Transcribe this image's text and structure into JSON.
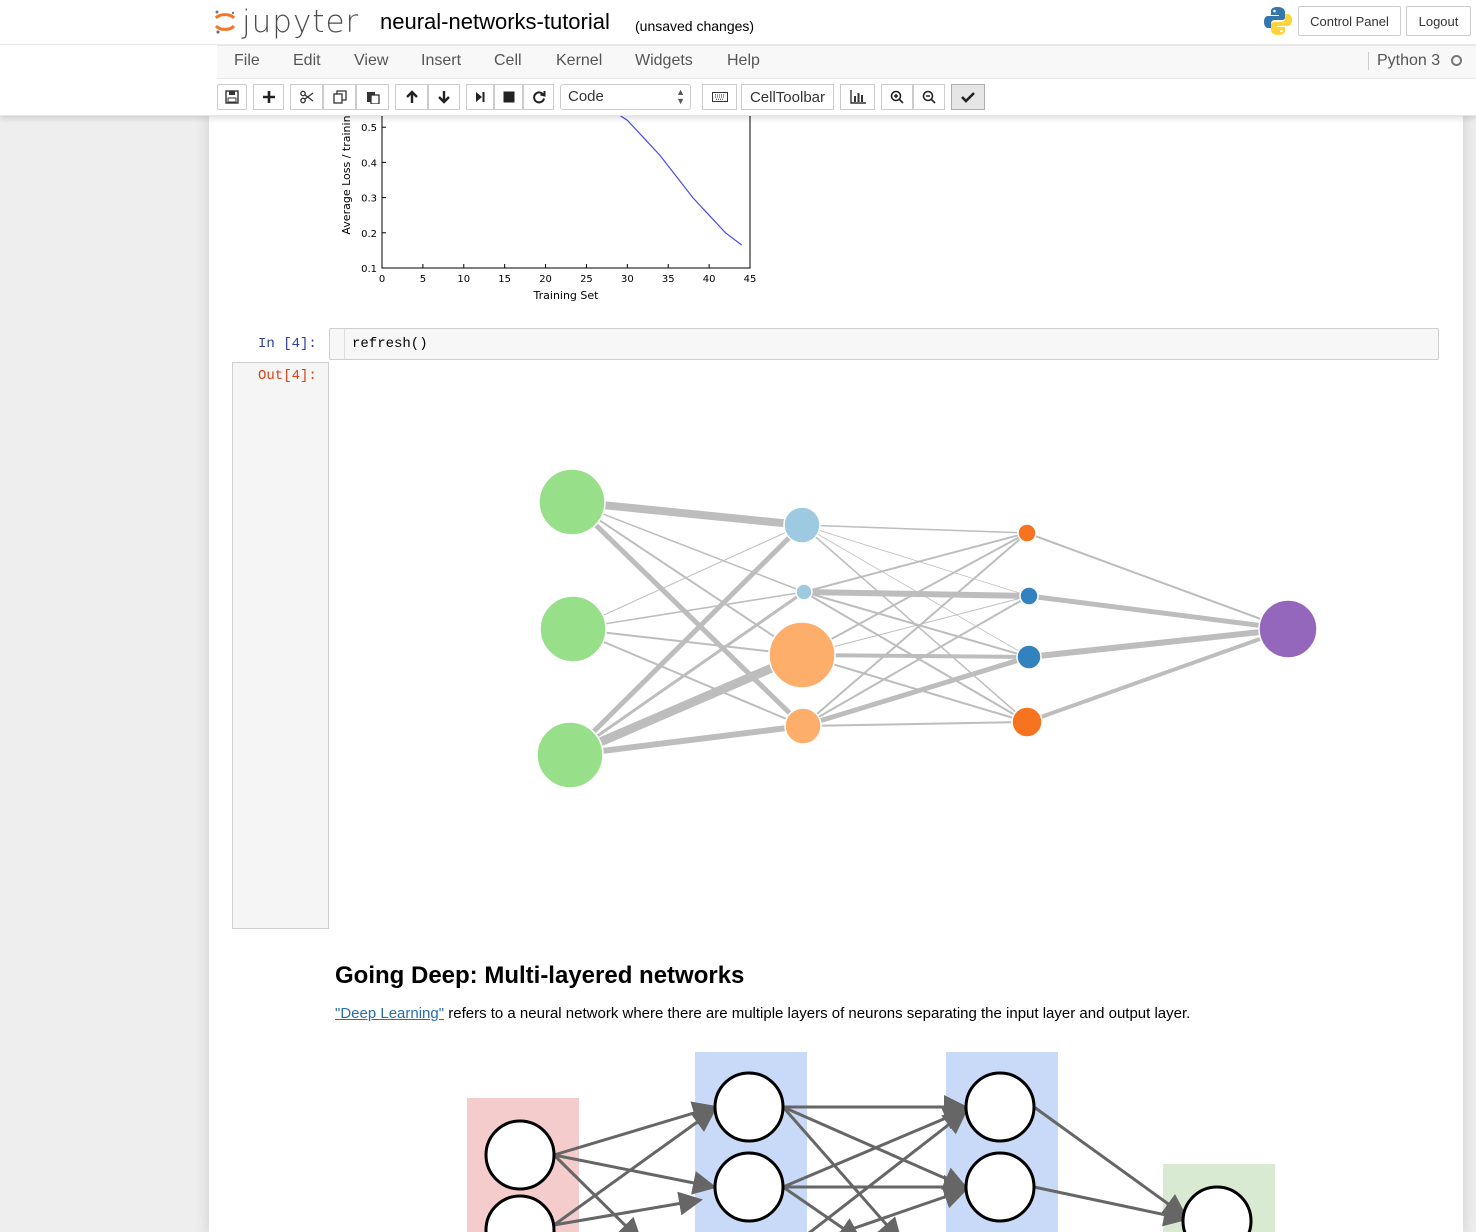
{
  "header": {
    "logo_text": "jupyter",
    "notebook_name": "neural-networks-tutorial",
    "save_status": "(unsaved changes)",
    "control_panel_label": "Control Panel",
    "logout_label": "Logout"
  },
  "menubar": {
    "items": [
      "File",
      "Edit",
      "View",
      "Insert",
      "Cell",
      "Kernel",
      "Widgets",
      "Help"
    ],
    "kernel_name": "Python 3"
  },
  "toolbar": {
    "icons": [
      "save-icon",
      "plus-icon",
      "cut-icon",
      "copy-icon",
      "paste-icon",
      "arrow-up-icon",
      "arrow-down-icon",
      "step-forward-icon",
      "stop-icon",
      "restart-icon"
    ],
    "cell_type": "Code",
    "celltoolbar_label": "CellToolbar"
  },
  "loss_chart": {
    "chart_data": {
      "type": "line",
      "ylabel": "Average Loss / trainin",
      "xlabel": "Training Set",
      "x_ticks": [
        "0",
        "5",
        "10",
        "15",
        "20",
        "25",
        "30",
        "35",
        "40",
        "45"
      ],
      "y_ticks": [
        "0.1",
        "0.2",
        "0.3",
        "0.4",
        "0.5"
      ],
      "xlim": [
        0,
        45
      ],
      "series": [
        {
          "x": [
            29,
            30,
            32,
            34,
            36,
            38,
            40,
            42,
            44
          ],
          "y": [
            0.54,
            0.52,
            0.47,
            0.42,
            0.36,
            0.3,
            0.25,
            0.2,
            0.165
          ]
        }
      ],
      "line_color": "#4a4ae8"
    }
  },
  "cells": {
    "in_prompt": "In [4]:",
    "code": "refresh()",
    "out_prompt": "Out[4]:"
  },
  "markdown": {
    "heading": "Going Deep: Multi-layered networks",
    "link_text": "\"Deep Learning\"",
    "body_text": " refers to a neural network where there are multiple layers of neurons separating the input layer and output layer."
  },
  "colors": {
    "input_node": "#98df8a",
    "hidden_light_blue": "#9ecae1",
    "hidden_orange_light": "#fdae6b",
    "hidden_blue": "#3182bd",
    "hidden_orange": "#f87320",
    "output_node": "#9467bd",
    "edge": "#bdbdbd",
    "deep_input_layer": "#f4cccc",
    "deep_hidden_layer": "#c9daf8",
    "deep_output_layer": "#d9ead3"
  }
}
